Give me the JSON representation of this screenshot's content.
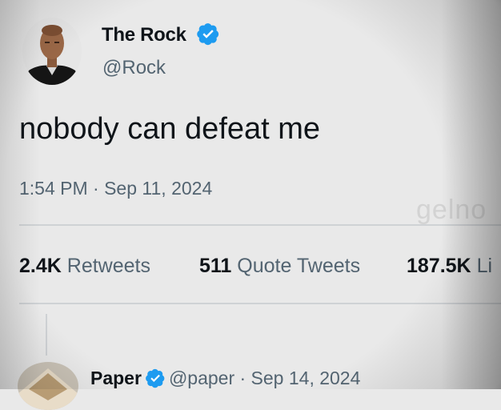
{
  "tweet": {
    "display_name": "The Rock",
    "handle": "@Rock",
    "verified": true,
    "text": "nobody can defeat me",
    "timestamp": "1:54 PM · Sep 11, 2024",
    "watermark": "gelno"
  },
  "stats": {
    "retweets_count": "2.4K",
    "retweets_label": "Retweets",
    "quote_count": "511",
    "quote_label": "Quote Tweets",
    "likes_count": "187.5K",
    "likes_label": "Li"
  },
  "reply": {
    "display_name": "Paper",
    "verified": true,
    "meta": "@paper · Sep 14, 2024"
  },
  "colors": {
    "verified_blue": "#1d9bf0",
    "text_primary": "#0f1419",
    "text_secondary": "#536471",
    "divider": "#cfd2d5"
  },
  "icons": {
    "verified": "verified-badge-icon",
    "avatar": "profile-avatar"
  }
}
